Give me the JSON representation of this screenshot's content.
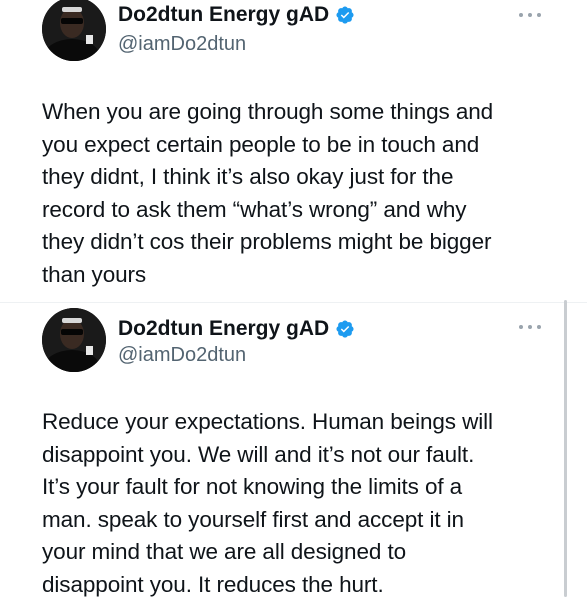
{
  "tweets": [
    {
      "display_name": "Do2dtun Energy gAD",
      "handle": "@iamDo2dtun",
      "verified": true,
      "avatar_icon": "profile-photo",
      "text": "When you are going through some things and\nyou expect certain people to be in touch and\nthey didnt, I think it’s also okay just for the\nrecord to ask them “what’s wrong” and why\nthey didn’t cos their problems might be bigger\nthan yours"
    },
    {
      "display_name": "Do2dtun Energy gAD",
      "handle": "@iamDo2dtun",
      "verified": true,
      "avatar_icon": "profile-photo",
      "text": "Reduce your expectations. Human beings will\ndisappoint you. We will and it’s not our fault.\nIt’s your fault for not knowing the limits of a\nman. speak to yourself first and accept it in\nyour mind that we are all designed to\ndisappoint you. It reduces the hurt."
    }
  ],
  "colors": {
    "text": "#0f1419",
    "handle": "#536471",
    "verified": "#1d9bf0",
    "more_dots": "#9aa4ad"
  }
}
